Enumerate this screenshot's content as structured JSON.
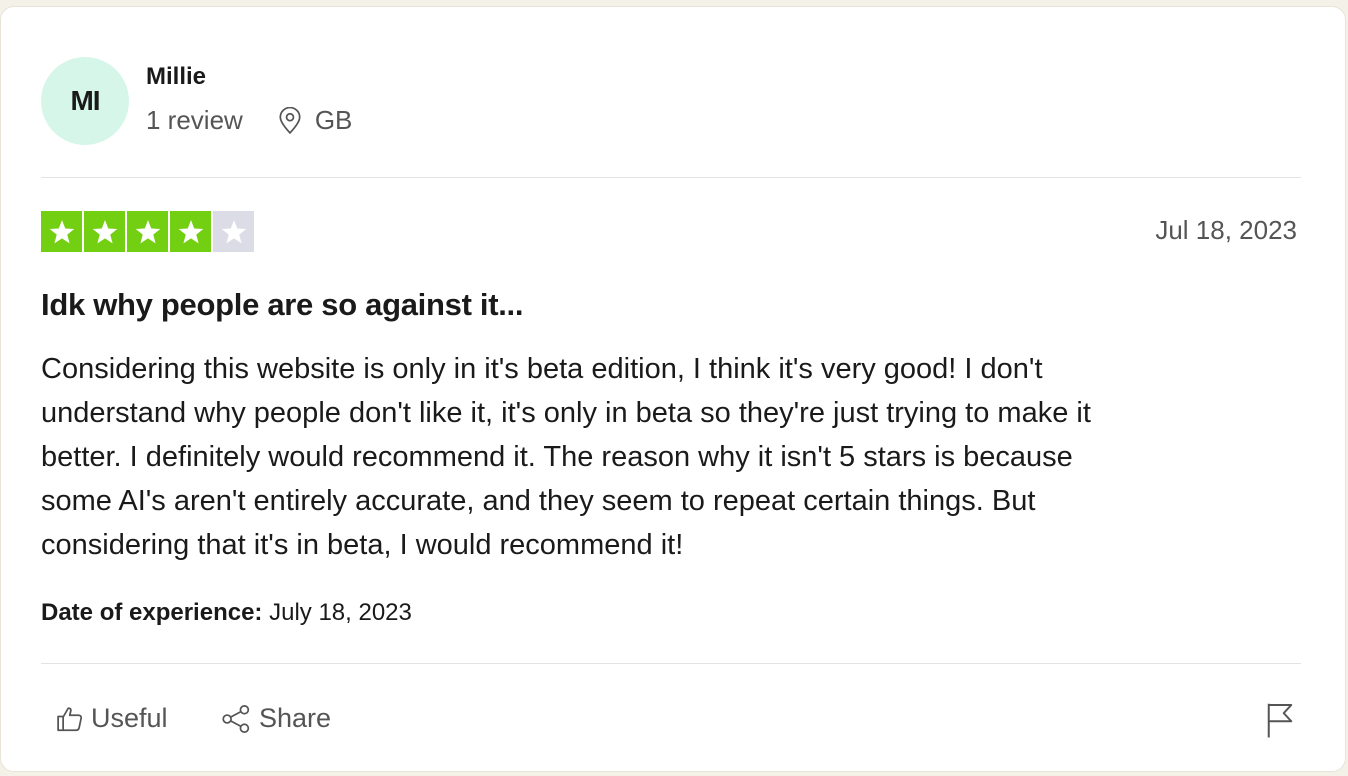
{
  "consumer": {
    "initials": "MI",
    "name": "Millie",
    "reviews": "1 review",
    "country": "GB"
  },
  "review": {
    "rating": 4,
    "max_rating": 5,
    "date": "Jul 18, 2023",
    "title": "Idk why people are so against it...",
    "body_lines": [
      "Considering this website is only in it's beta edition, I think it's very good! I don't",
      "understand why people don't like it, it's only in beta so they're just trying to make it",
      "better. I definitely would recommend it. The reason why it isn't 5 stars is because",
      "some AI's aren't entirely accurate, and they seem to repeat certain things. But",
      "considering that it's in beta, I would recommend it!"
    ],
    "experience_label": "Date of experience:",
    "experience_date": "July 18, 2023"
  },
  "actions": {
    "useful_label": "Useful",
    "share_label": "Share"
  },
  "icons": {
    "location": "location-pin-icon",
    "useful": "thumbs-up-icon",
    "share": "share-icon",
    "report": "flag-icon",
    "star": "star-icon"
  },
  "colors": {
    "star_filled": "#73cf11",
    "star_empty": "#dcdce6",
    "avatar_bg": "#d6f6ea"
  }
}
